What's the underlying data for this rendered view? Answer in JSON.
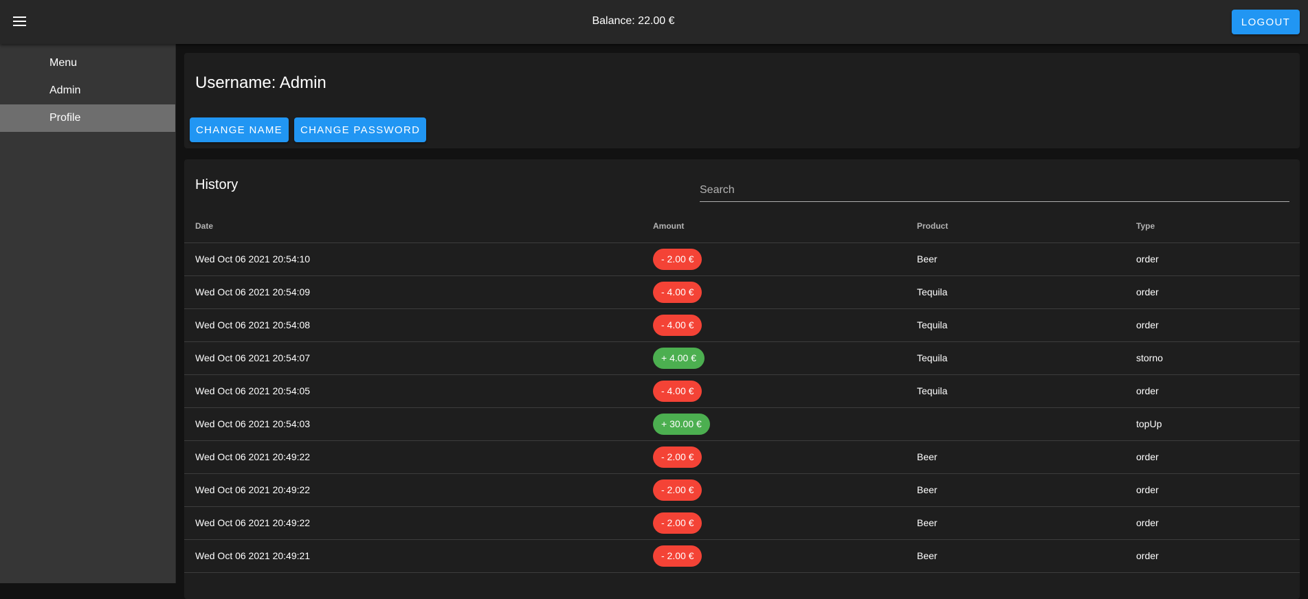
{
  "appbar": {
    "balance": "Balance: 22.00 €",
    "logout_label": "Logout",
    "menu_icon": "hamburger-menu-icon"
  },
  "sidebar": {
    "items": [
      {
        "label": "Menu",
        "active": false
      },
      {
        "label": "Admin",
        "active": false
      },
      {
        "label": "Profile",
        "active": true
      }
    ]
  },
  "profile": {
    "username": "Username: Admin",
    "change_name_label": "Change Name",
    "change_password_label": "Change Password"
  },
  "history": {
    "title": "History",
    "search_placeholder": "Search",
    "columns": [
      "Date",
      "Amount",
      "Product",
      "Type"
    ],
    "rows": [
      {
        "date": "Wed Oct 06 2021 20:54:10",
        "amount": "- 2.00 €",
        "sign": "neg",
        "product": "Beer",
        "type": "order"
      },
      {
        "date": "Wed Oct 06 2021 20:54:09",
        "amount": "- 4.00 €",
        "sign": "neg",
        "product": "Tequila",
        "type": "order"
      },
      {
        "date": "Wed Oct 06 2021 20:54:08",
        "amount": "- 4.00 €",
        "sign": "neg",
        "product": "Tequila",
        "type": "order"
      },
      {
        "date": "Wed Oct 06 2021 20:54:07",
        "amount": "+ 4.00 €",
        "sign": "pos",
        "product": "Tequila",
        "type": "storno"
      },
      {
        "date": "Wed Oct 06 2021 20:54:05",
        "amount": "- 4.00 €",
        "sign": "neg",
        "product": "Tequila",
        "type": "order"
      },
      {
        "date": "Wed Oct 06 2021 20:54:03",
        "amount": "+ 30.00 €",
        "sign": "pos",
        "product": "",
        "type": "topUp"
      },
      {
        "date": "Wed Oct 06 2021 20:49:22",
        "amount": "- 2.00 €",
        "sign": "neg",
        "product": "Beer",
        "type": "order"
      },
      {
        "date": "Wed Oct 06 2021 20:49:22",
        "amount": "- 2.00 €",
        "sign": "neg",
        "product": "Beer",
        "type": "order"
      },
      {
        "date": "Wed Oct 06 2021 20:49:22",
        "amount": "- 2.00 €",
        "sign": "neg",
        "product": "Beer",
        "type": "order"
      },
      {
        "date": "Wed Oct 06 2021 20:49:21",
        "amount": "- 2.00 €",
        "sign": "neg",
        "product": "Beer",
        "type": "order"
      }
    ]
  },
  "colors": {
    "primary": "#2196f3",
    "negative": "#f44336",
    "positive": "#4caf50",
    "appbar": "#272727",
    "sidebar": "#363636",
    "card": "#1e1e1e"
  }
}
